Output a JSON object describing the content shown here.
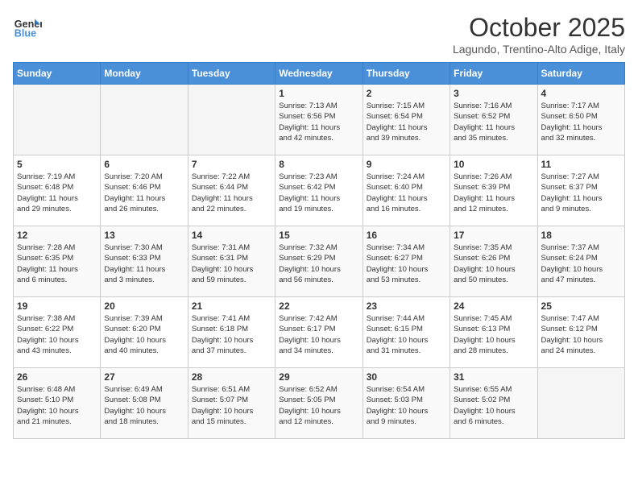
{
  "header": {
    "logo_line1": "General",
    "logo_line2": "Blue",
    "month": "October 2025",
    "location": "Lagundo, Trentino-Alto Adige, Italy"
  },
  "days_of_week": [
    "Sunday",
    "Monday",
    "Tuesday",
    "Wednesday",
    "Thursday",
    "Friday",
    "Saturday"
  ],
  "weeks": [
    [
      {
        "day": "",
        "info": ""
      },
      {
        "day": "",
        "info": ""
      },
      {
        "day": "",
        "info": ""
      },
      {
        "day": "1",
        "info": "Sunrise: 7:13 AM\nSunset: 6:56 PM\nDaylight: 11 hours\nand 42 minutes."
      },
      {
        "day": "2",
        "info": "Sunrise: 7:15 AM\nSunset: 6:54 PM\nDaylight: 11 hours\nand 39 minutes."
      },
      {
        "day": "3",
        "info": "Sunrise: 7:16 AM\nSunset: 6:52 PM\nDaylight: 11 hours\nand 35 minutes."
      },
      {
        "day": "4",
        "info": "Sunrise: 7:17 AM\nSunset: 6:50 PM\nDaylight: 11 hours\nand 32 minutes."
      }
    ],
    [
      {
        "day": "5",
        "info": "Sunrise: 7:19 AM\nSunset: 6:48 PM\nDaylight: 11 hours\nand 29 minutes."
      },
      {
        "day": "6",
        "info": "Sunrise: 7:20 AM\nSunset: 6:46 PM\nDaylight: 11 hours\nand 26 minutes."
      },
      {
        "day": "7",
        "info": "Sunrise: 7:22 AM\nSunset: 6:44 PM\nDaylight: 11 hours\nand 22 minutes."
      },
      {
        "day": "8",
        "info": "Sunrise: 7:23 AM\nSunset: 6:42 PM\nDaylight: 11 hours\nand 19 minutes."
      },
      {
        "day": "9",
        "info": "Sunrise: 7:24 AM\nSunset: 6:40 PM\nDaylight: 11 hours\nand 16 minutes."
      },
      {
        "day": "10",
        "info": "Sunrise: 7:26 AM\nSunset: 6:39 PM\nDaylight: 11 hours\nand 12 minutes."
      },
      {
        "day": "11",
        "info": "Sunrise: 7:27 AM\nSunset: 6:37 PM\nDaylight: 11 hours\nand 9 minutes."
      }
    ],
    [
      {
        "day": "12",
        "info": "Sunrise: 7:28 AM\nSunset: 6:35 PM\nDaylight: 11 hours\nand 6 minutes."
      },
      {
        "day": "13",
        "info": "Sunrise: 7:30 AM\nSunset: 6:33 PM\nDaylight: 11 hours\nand 3 minutes."
      },
      {
        "day": "14",
        "info": "Sunrise: 7:31 AM\nSunset: 6:31 PM\nDaylight: 10 hours\nand 59 minutes."
      },
      {
        "day": "15",
        "info": "Sunrise: 7:32 AM\nSunset: 6:29 PM\nDaylight: 10 hours\nand 56 minutes."
      },
      {
        "day": "16",
        "info": "Sunrise: 7:34 AM\nSunset: 6:27 PM\nDaylight: 10 hours\nand 53 minutes."
      },
      {
        "day": "17",
        "info": "Sunrise: 7:35 AM\nSunset: 6:26 PM\nDaylight: 10 hours\nand 50 minutes."
      },
      {
        "day": "18",
        "info": "Sunrise: 7:37 AM\nSunset: 6:24 PM\nDaylight: 10 hours\nand 47 minutes."
      }
    ],
    [
      {
        "day": "19",
        "info": "Sunrise: 7:38 AM\nSunset: 6:22 PM\nDaylight: 10 hours\nand 43 minutes."
      },
      {
        "day": "20",
        "info": "Sunrise: 7:39 AM\nSunset: 6:20 PM\nDaylight: 10 hours\nand 40 minutes."
      },
      {
        "day": "21",
        "info": "Sunrise: 7:41 AM\nSunset: 6:18 PM\nDaylight: 10 hours\nand 37 minutes."
      },
      {
        "day": "22",
        "info": "Sunrise: 7:42 AM\nSunset: 6:17 PM\nDaylight: 10 hours\nand 34 minutes."
      },
      {
        "day": "23",
        "info": "Sunrise: 7:44 AM\nSunset: 6:15 PM\nDaylight: 10 hours\nand 31 minutes."
      },
      {
        "day": "24",
        "info": "Sunrise: 7:45 AM\nSunset: 6:13 PM\nDaylight: 10 hours\nand 28 minutes."
      },
      {
        "day": "25",
        "info": "Sunrise: 7:47 AM\nSunset: 6:12 PM\nDaylight: 10 hours\nand 24 minutes."
      }
    ],
    [
      {
        "day": "26",
        "info": "Sunrise: 6:48 AM\nSunset: 5:10 PM\nDaylight: 10 hours\nand 21 minutes."
      },
      {
        "day": "27",
        "info": "Sunrise: 6:49 AM\nSunset: 5:08 PM\nDaylight: 10 hours\nand 18 minutes."
      },
      {
        "day": "28",
        "info": "Sunrise: 6:51 AM\nSunset: 5:07 PM\nDaylight: 10 hours\nand 15 minutes."
      },
      {
        "day": "29",
        "info": "Sunrise: 6:52 AM\nSunset: 5:05 PM\nDaylight: 10 hours\nand 12 minutes."
      },
      {
        "day": "30",
        "info": "Sunrise: 6:54 AM\nSunset: 5:03 PM\nDaylight: 10 hours\nand 9 minutes."
      },
      {
        "day": "31",
        "info": "Sunrise: 6:55 AM\nSunset: 5:02 PM\nDaylight: 10 hours\nand 6 minutes."
      },
      {
        "day": "",
        "info": ""
      }
    ]
  ]
}
